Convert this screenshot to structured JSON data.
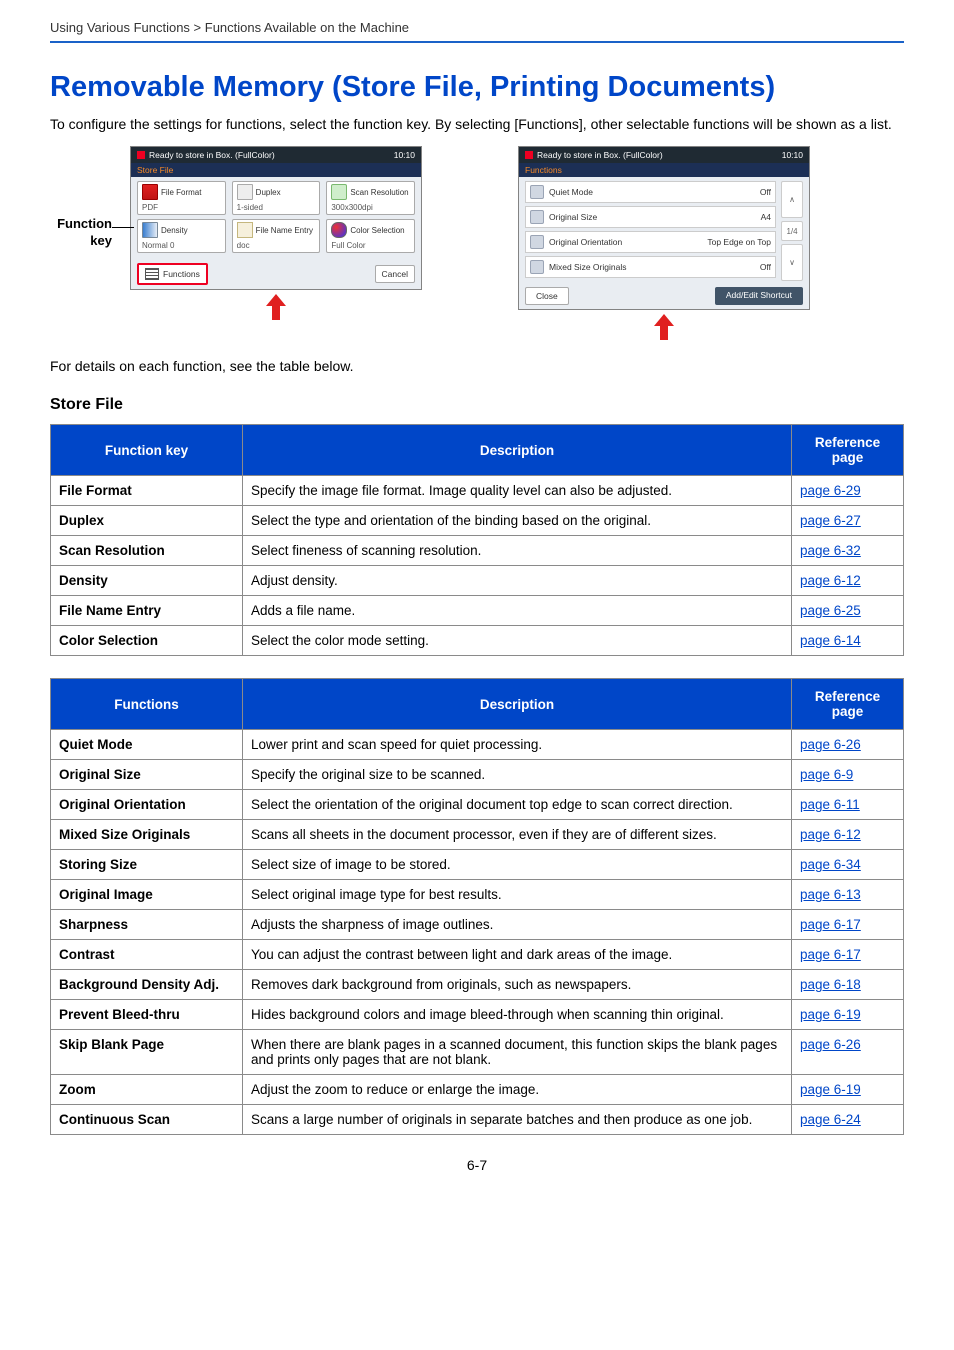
{
  "breadcrumb": "Using Various Functions > Functions Available on the Machine",
  "title": "Removable Memory (Store File, Printing Documents)",
  "intro": "To configure the settings for functions, select the function key. By selecting [Functions], other selectable functions will be shown as a list.",
  "fk_label_1": "Function",
  "fk_label_2": "key",
  "note": "For details on each function, see the table below.",
  "store_heading": "Store File",
  "panel1": {
    "status": "Ready to store in Box. (FullColor)",
    "time": "10:10",
    "sub": "Store File",
    "tiles": [
      {
        "label": "File Format",
        "val": "PDF",
        "ic": "pdf"
      },
      {
        "label": "Duplex",
        "val": "1-sided",
        "ic": "dup"
      },
      {
        "label": "Scan Resolution",
        "val": "300x300dpi",
        "ic": "scan"
      },
      {
        "label": "Density",
        "val": "Normal 0",
        "ic": "den"
      },
      {
        "label": "File Name Entry",
        "val": "doc",
        "ic": "fn",
        "sub": "ab cde"
      },
      {
        "label": "Color Selection",
        "val": "Full Color",
        "ic": "col"
      }
    ],
    "functions": "Functions",
    "cancel": "Cancel"
  },
  "panel2": {
    "status": "Ready to store in Box. (FullColor)",
    "time": "10:10",
    "sub": "Functions",
    "rows": [
      {
        "label": "Quiet Mode",
        "val": "Off"
      },
      {
        "label": "Original Size",
        "val": "A4"
      },
      {
        "label": "Original Orientation",
        "val": "Top Edge on Top"
      },
      {
        "label": "Mixed Size Originals",
        "val": "Off"
      }
    ],
    "page": "1/4",
    "close": "Close",
    "shortcut": "Add/Edit Shortcut"
  },
  "table1": {
    "h1": "Function key",
    "h2": "Description",
    "h3": "Reference page",
    "rows": [
      {
        "fn": "File Format",
        "desc": "Specify the image file format. Image quality level can also be adjusted.",
        "ref": "page 6-29"
      },
      {
        "fn": "Duplex",
        "desc": "Select the type and orientation of the binding based on the original.",
        "ref": "page 6-27"
      },
      {
        "fn": "Scan Resolution",
        "desc": "Select fineness of scanning resolution.",
        "ref": "page 6-32"
      },
      {
        "fn": "Density",
        "desc": "Adjust density.",
        "ref": "page 6-12"
      },
      {
        "fn": "File Name Entry",
        "desc": "Adds a file name.",
        "ref": "page 6-25"
      },
      {
        "fn": "Color Selection",
        "desc": "Select the color mode setting.",
        "ref": "page 6-14"
      }
    ]
  },
  "table2": {
    "h1": "Functions",
    "h2": "Description",
    "h3": "Reference page",
    "rows": [
      {
        "fn": "Quiet Mode",
        "desc": "Lower print and scan speed for quiet processing.",
        "ref": "page 6-26"
      },
      {
        "fn": "Original Size",
        "desc": "Specify the original size to be scanned.",
        "ref": "page 6-9"
      },
      {
        "fn": "Original Orientation",
        "desc": "Select the orientation of the original document top edge to scan correct direction.",
        "ref": "page 6-11"
      },
      {
        "fn": "Mixed Size Originals",
        "desc": "Scans all sheets in the document processor, even if they are of different sizes.",
        "ref": "page 6-12"
      },
      {
        "fn": "Storing Size",
        "desc": "Select size of image to be stored.",
        "ref": "page 6-34"
      },
      {
        "fn": "Original Image",
        "desc": "Select original image type for best results.",
        "ref": "page 6-13"
      },
      {
        "fn": "Sharpness",
        "desc": "Adjusts the sharpness of image outlines.",
        "ref": "page 6-17"
      },
      {
        "fn": "Contrast",
        "desc": "You can adjust the contrast between light and dark areas of the image.",
        "ref": "page 6-17"
      },
      {
        "fn": "Background Density Adj.",
        "desc": "Removes dark background from originals, such as newspapers.",
        "ref": "page 6-18"
      },
      {
        "fn": "Prevent Bleed-thru",
        "desc": "Hides background colors and image bleed-through when scanning thin original.",
        "ref": "page 6-19"
      },
      {
        "fn": "Skip Blank Page",
        "desc": "When there are blank pages in a scanned document, this function skips the blank pages and prints only pages that are not blank.",
        "ref": "page 6-26"
      },
      {
        "fn": "Zoom",
        "desc": "Adjust the zoom to reduce or enlarge the image.",
        "ref": "page 6-19"
      },
      {
        "fn": "Continuous Scan",
        "desc": "Scans a large number of originals in separate batches and then produce as one job.",
        "ref": "page 6-24"
      }
    ]
  },
  "pagenum": "6-7"
}
